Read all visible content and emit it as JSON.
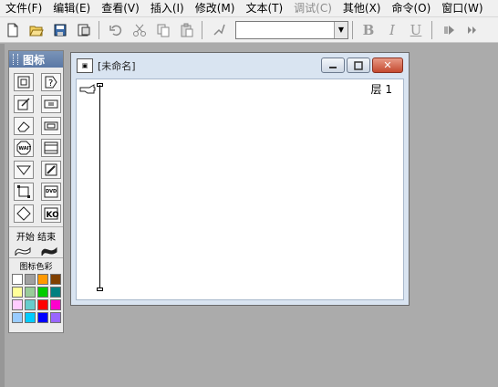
{
  "menubar": {
    "items": [
      "文件(F)",
      "编辑(E)",
      "查看(V)",
      "插入(I)",
      "修改(M)",
      "文本(T)",
      "调试(C)",
      "其他(X)",
      "命令(O)",
      "窗口(W)"
    ],
    "disabled_index": 6
  },
  "toolbar": {
    "font_value": "",
    "bold": "B",
    "italic": "I",
    "underline": "U"
  },
  "palette": {
    "title": "图标",
    "flag_label": "开始 结束",
    "color_label": "图标色彩",
    "colors": [
      "#ffffff",
      "#a0a0a0",
      "#ff9900",
      "#804000",
      "#ffff99",
      "#99cc99",
      "#00cc00",
      "#008080",
      "#ffccff",
      "#66cccc",
      "#ff0000",
      "#ff00cc",
      "#99ccff",
      "#00ccff",
      "#0000ff",
      "#9966ff"
    ]
  },
  "design_window": {
    "title": "[未命名]",
    "close_glyph": "✕",
    "layer_label": "层 1",
    "icon_glyph": "▣"
  }
}
